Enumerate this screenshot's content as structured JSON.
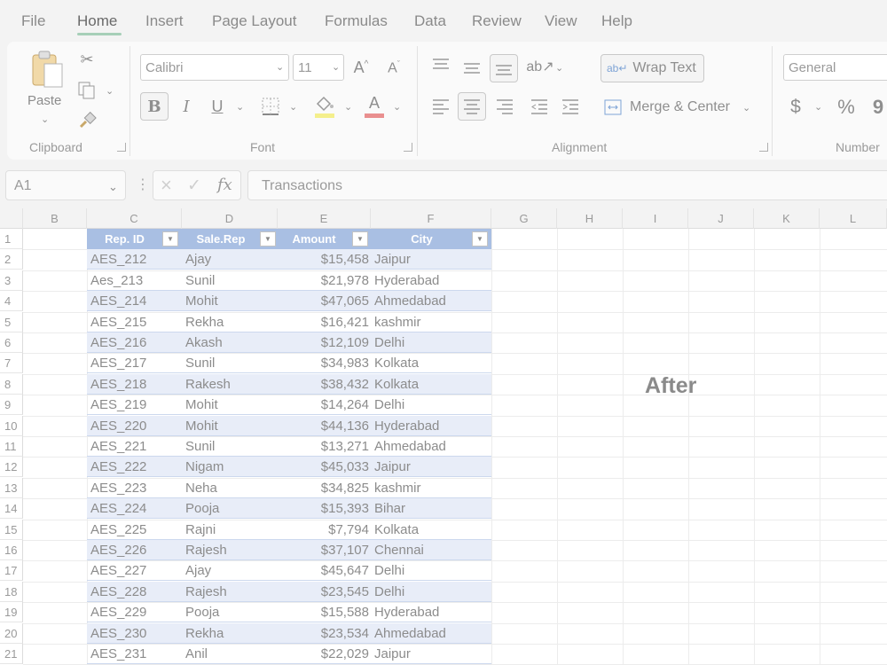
{
  "menu": {
    "items": [
      "File",
      "Home",
      "Insert",
      "Page Layout",
      "Formulas",
      "Data",
      "Review",
      "View",
      "Help"
    ],
    "active": "Home"
  },
  "ribbon": {
    "clipboard": {
      "paste_label": "Paste",
      "group_label": "Clipboard"
    },
    "font": {
      "font_name": "Calibri",
      "font_size": "11",
      "bold": "B",
      "italic": "I",
      "underline": "U",
      "font_color": "A",
      "group_label": "Font"
    },
    "alignment": {
      "wrap_text": "Wrap Text",
      "merge_center": "Merge & Center",
      "group_label": "Alignment"
    },
    "number": {
      "format": "General",
      "currency": "$",
      "percent": "%",
      "comma": "9",
      "group_label": "Number"
    }
  },
  "formula_bar": {
    "name_box": "A1",
    "fx": "fx",
    "content": "Transactions"
  },
  "grid": {
    "columns": [
      "B",
      "C",
      "D",
      "E",
      "F",
      "G",
      "H",
      "I",
      "J",
      "K",
      "L"
    ],
    "rows": [
      "1",
      "2",
      "3",
      "4",
      "5",
      "6",
      "7",
      "8",
      "9",
      "10",
      "11",
      "12",
      "13",
      "14",
      "15",
      "16",
      "17",
      "18",
      "19",
      "20",
      "21"
    ]
  },
  "table": {
    "headers": [
      "Rep. ID",
      "Sale.Rep",
      "Amount",
      "City"
    ],
    "rows": [
      [
        "AES_212",
        "Ajay",
        "$15,458",
        "Jaipur"
      ],
      [
        "Aes_213",
        "Sunil",
        "$21,978",
        "Hyderabad"
      ],
      [
        "AES_214",
        "Mohit",
        "$47,065",
        "Ahmedabad"
      ],
      [
        "AES_215",
        "Rekha",
        "$16,421",
        "kashmir"
      ],
      [
        "AES_216",
        "Akash",
        "$12,109",
        "Delhi"
      ],
      [
        "AES_217",
        "Sunil",
        "$34,983",
        "Kolkata"
      ],
      [
        "AES_218",
        "Rakesh",
        "$38,432",
        "Kolkata"
      ],
      [
        "AES_219",
        "Mohit",
        "$14,264",
        "Delhi"
      ],
      [
        "AES_220",
        "Mohit",
        "$44,136",
        "Hyderabad"
      ],
      [
        "AES_221",
        "Sunil",
        "$13,271",
        "Ahmedabad"
      ],
      [
        "AES_222",
        "Nigam",
        "$45,033",
        "Jaipur"
      ],
      [
        "AES_223",
        "Neha",
        "$34,825",
        "kashmir"
      ],
      [
        "AES_224",
        "Pooja",
        "$15,393",
        "Bihar"
      ],
      [
        "AES_225",
        "Rajni",
        "$7,794",
        "Kolkata"
      ],
      [
        "AES_226",
        "Rajesh",
        "$37,107",
        "Chennai"
      ],
      [
        "AES_227",
        "Ajay",
        "$45,647",
        "Delhi"
      ],
      [
        "AES_228",
        "Rajesh",
        "$23,545",
        "Delhi"
      ],
      [
        "AES_229",
        "Pooja",
        "$15,588",
        "Hyderabad"
      ],
      [
        "AES_230",
        "Rekha",
        "$23,534",
        "Ahmedabad"
      ],
      [
        "AES_231",
        "Anil",
        "$22,029",
        "Jaipur"
      ]
    ]
  },
  "overlay_text": "After",
  "colors": {
    "table_header": "#a9bfe3",
    "band": "#e8edf8",
    "accent": "#a6cfb8"
  }
}
